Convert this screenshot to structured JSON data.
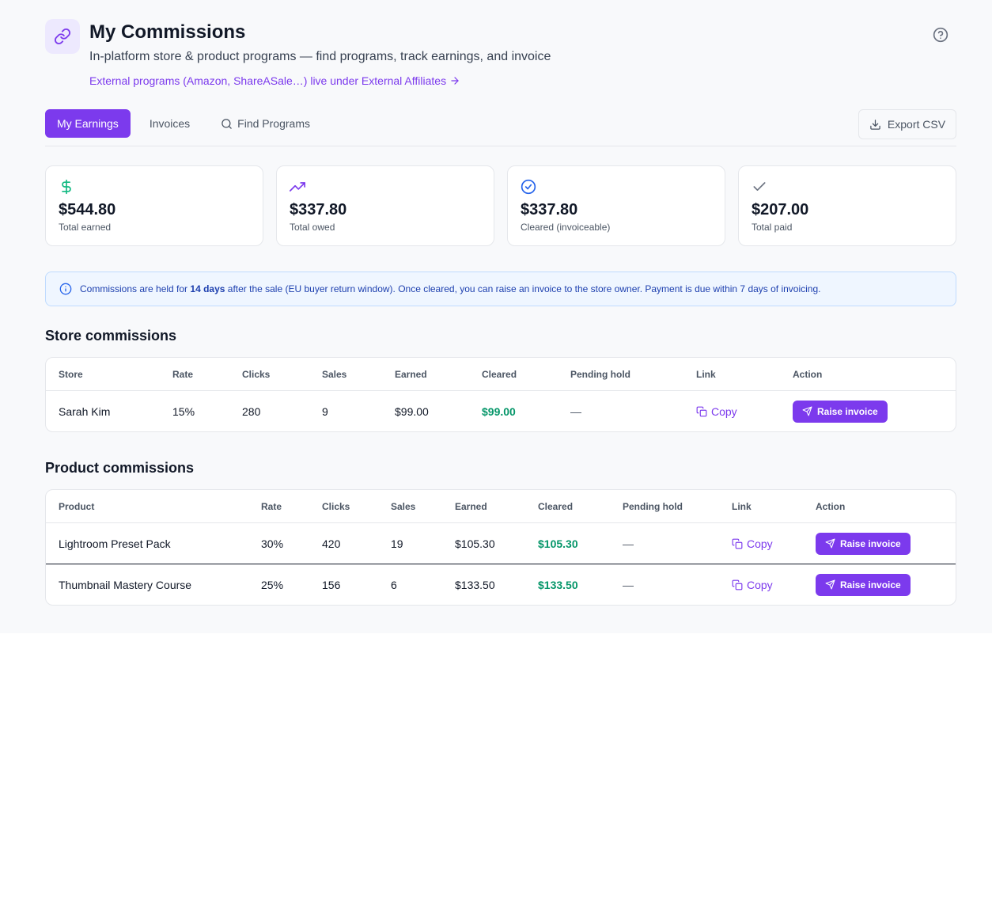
{
  "header": {
    "title": "My Commissions",
    "subtitle": "In-platform store & product programs — find programs, track earnings, and invoice",
    "external_link": "External programs (Amazon, ShareASale…) live under External Affiliates"
  },
  "tabs": [
    {
      "label": "My Earnings",
      "active": true
    },
    {
      "label": "Invoices",
      "active": false
    },
    {
      "label": "Find Programs",
      "active": false
    }
  ],
  "export_label": "Export CSV",
  "stats": [
    {
      "icon": "dollar-icon",
      "value": "$544.80",
      "label": "Total earned",
      "color": "#10b981"
    },
    {
      "icon": "trending-up-icon",
      "value": "$337.80",
      "label": "Total owed",
      "color": "#7c3aed"
    },
    {
      "icon": "check-circle-icon",
      "value": "$337.80",
      "label": "Cleared (invoiceable)",
      "color": "#2563eb"
    },
    {
      "icon": "check-icon",
      "value": "$207.00",
      "label": "Total paid",
      "color": "#6b7280"
    }
  ],
  "info": {
    "pre": "Commissions are held for ",
    "bold": "14 days",
    "post": " after the sale (EU buyer return window). Once cleared, you can raise an invoice to the store owner. Payment is due within 7 days of invoicing."
  },
  "store_section": {
    "title": "Store commissions",
    "headers": [
      "Store",
      "Rate",
      "Clicks",
      "Sales",
      "Earned",
      "Cleared",
      "Pending hold",
      "Link",
      "Action"
    ],
    "rows": [
      {
        "name": "Sarah Kim",
        "rate": "15%",
        "clicks": "280",
        "sales": "9",
        "earned": "$99.00",
        "cleared": "$99.00",
        "pending": "—",
        "link": "Copy",
        "action": "Raise invoice"
      }
    ]
  },
  "product_section": {
    "title": "Product commissions",
    "headers": [
      "Product",
      "Rate",
      "Clicks",
      "Sales",
      "Earned",
      "Cleared",
      "Pending hold",
      "Link",
      "Action"
    ],
    "rows": [
      {
        "name": "Lightroom Preset Pack",
        "rate": "30%",
        "clicks": "420",
        "sales": "19",
        "earned": "$105.30",
        "cleared": "$105.30",
        "pending": "—",
        "link": "Copy",
        "action": "Raise invoice"
      },
      {
        "name": "Thumbnail Mastery Course",
        "rate": "25%",
        "clicks": "156",
        "sales": "6",
        "earned": "$133.50",
        "cleared": "$133.50",
        "pending": "—",
        "link": "Copy",
        "action": "Raise invoice"
      }
    ]
  },
  "colors": {
    "accent": "#7c3aed",
    "cleared": "#059669",
    "info_bg": "#eff6ff",
    "info_text": "#1e40af"
  }
}
